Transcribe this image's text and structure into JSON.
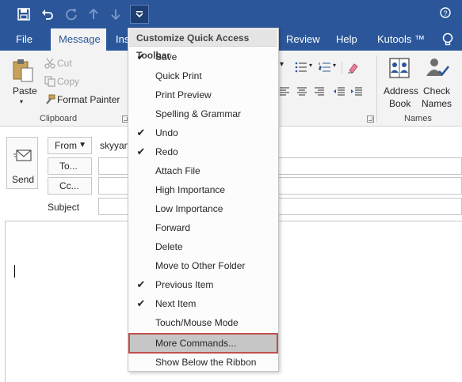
{
  "ribbon_tabs": [
    "File",
    "Message",
    "Ins",
    "Review",
    "Help",
    "Kutools ™"
  ],
  "selected_tab": "Message",
  "clipboard": {
    "paste": "Paste",
    "cut": "Cut",
    "copy": "Copy",
    "format_painter": "Format Painter",
    "group_label": "Clipboard"
  },
  "names": {
    "address_book_1": "Address",
    "address_book_2": "Book",
    "check_names_1": "Check",
    "check_names_2": "Names",
    "group_label": "Names"
  },
  "compose": {
    "send": "Send",
    "from": "From",
    "from_value": "skyyan",
    "to": "To...",
    "cc": "Cc...",
    "subject": "Subject"
  },
  "menu": {
    "title": "Customize Quick Access Toolbar",
    "items": [
      {
        "label": "Save",
        "checked": "✔"
      },
      {
        "label": "Quick Print",
        "checked": ""
      },
      {
        "label": "Print Preview",
        "checked": ""
      },
      {
        "label": "Spelling & Grammar",
        "checked": ""
      },
      {
        "label": "Undo",
        "checked": "✔"
      },
      {
        "label": "Redo",
        "checked": "✔"
      },
      {
        "label": "Attach File",
        "checked": ""
      },
      {
        "label": "High Importance",
        "checked": ""
      },
      {
        "label": "Low Importance",
        "checked": ""
      },
      {
        "label": "Forward",
        "checked": ""
      },
      {
        "label": "Delete",
        "checked": ""
      },
      {
        "label": "Move to Other Folder",
        "checked": ""
      },
      {
        "label": "Previous Item",
        "checked": "✔"
      },
      {
        "label": "Next Item",
        "checked": "✔"
      },
      {
        "label": "Touch/Mouse Mode",
        "checked": ""
      }
    ],
    "more_commands": "More Commands...",
    "show_below": "Show Below the Ribbon"
  },
  "colors": {
    "title_bar": "#2b579a",
    "highlight_outline": "#c0504d",
    "hover": "#c6c6c6"
  }
}
